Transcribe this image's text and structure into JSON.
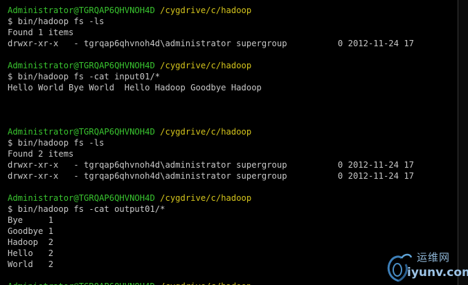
{
  "prompt": {
    "user": "Administrator@TGRQAP6QHVNOH4D",
    "path": "/cygdrive/c/hadoop"
  },
  "lines": [
    "$ bin/hadoop fs -ls",
    "Found 1 items",
    "drwxr-xr-x   - tgrqap6qhvnoh4d\\administrator supergroup          0 2012-11-24 17",
    "$ bin/hadoop fs -cat input01/*",
    "Hello World Bye World  Hello Hadoop Goodbye Hadoop",
    "$ bin/hadoop fs -ls",
    "Found 2 items",
    "drwxr-xr-x   - tgrqap6qhvnoh4d\\administrator supergroup          0 2012-11-24 17",
    "drwxr-xr-x   - tgrqap6qhvnoh4d\\administrator supergroup          0 2012-11-24 17",
    "$ bin/hadoop fs -cat output01/*",
    "Bye     1",
    "Goodbye 1",
    "Hadoop  2",
    "Hello   2",
    "World   2"
  ],
  "watermark": {
    "top_text": "运维网",
    "bottom_text": "iyunv.com",
    "icon": "swirl-logo-icon"
  },
  "colors": {
    "background": "#000000",
    "prompt_user": "#39c42f",
    "prompt_path": "#d4c41c",
    "output_text": "#c8c8c8"
  }
}
